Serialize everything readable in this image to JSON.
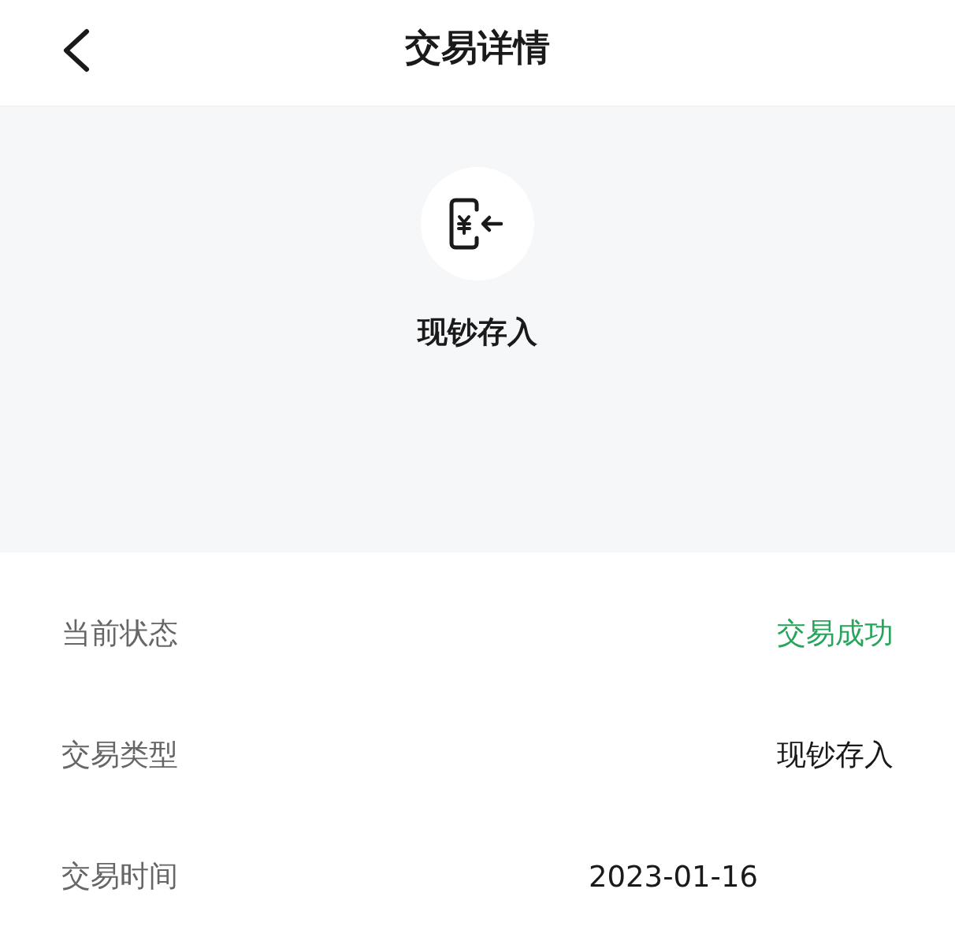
{
  "header": {
    "title": "交易详情"
  },
  "summary": {
    "type_label": "现钞存入"
  },
  "details": [
    {
      "label": "当前状态",
      "value": "交易成功",
      "kind": "status"
    },
    {
      "label": "交易类型",
      "value": "现钞存入",
      "kind": "plain"
    },
    {
      "label": "交易时间",
      "value": "2023-01-16",
      "kind": "time"
    }
  ]
}
